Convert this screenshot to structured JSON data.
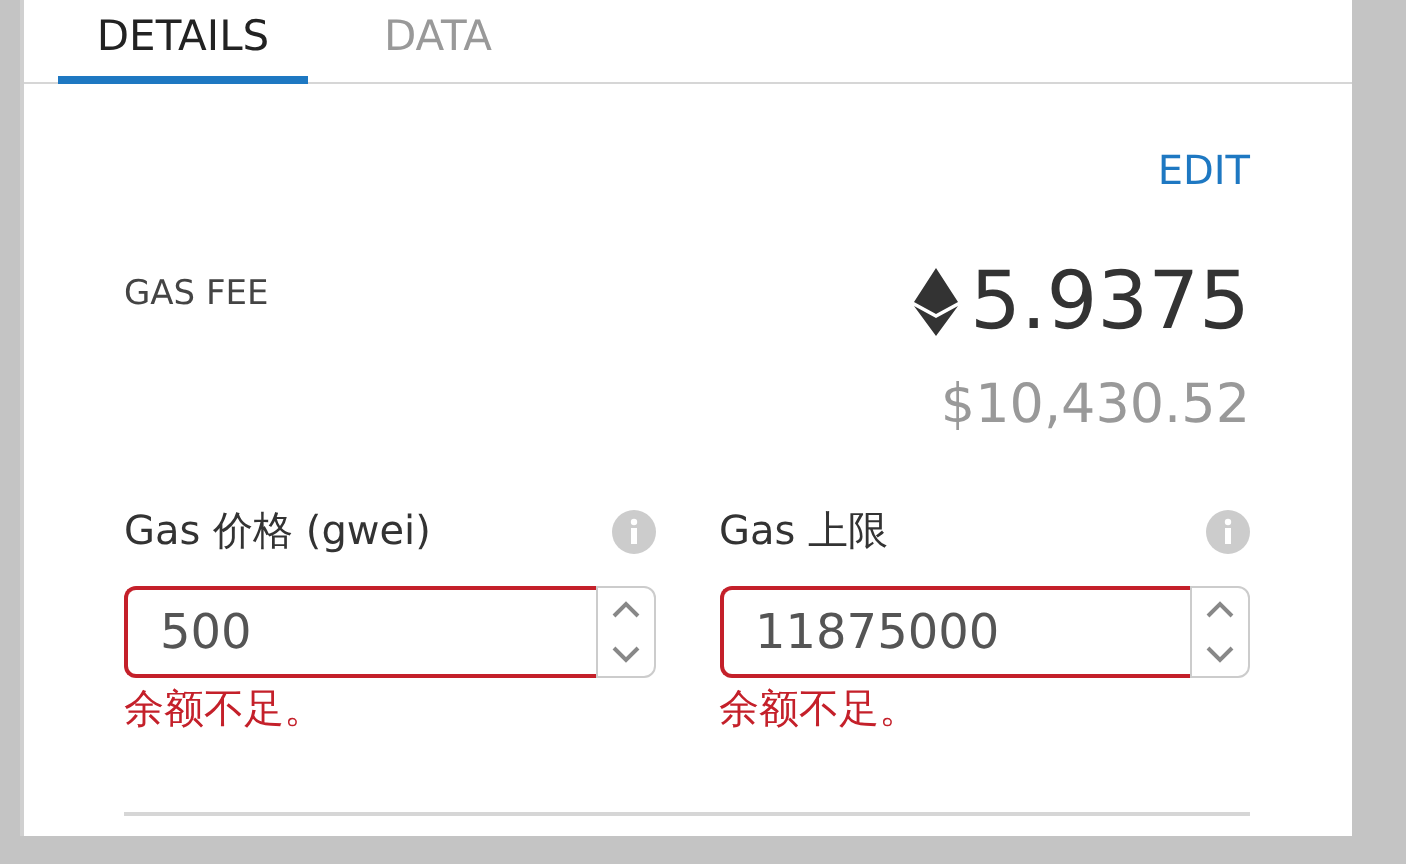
{
  "tabs": [
    {
      "label": "DETAILS",
      "selected": true
    },
    {
      "label": "DATA",
      "selected": false
    }
  ],
  "edit_link": "EDIT",
  "gas_fee": {
    "label": "GAS FEE",
    "amount": "5.9375",
    "fiat": "$10,430.52"
  },
  "fields": [
    {
      "label": "Gas 价格 (gwei)",
      "value": "500",
      "error": "余额不足。"
    },
    {
      "label": "Gas 上限",
      "value": "11875000",
      "error": "余额不足。"
    }
  ]
}
